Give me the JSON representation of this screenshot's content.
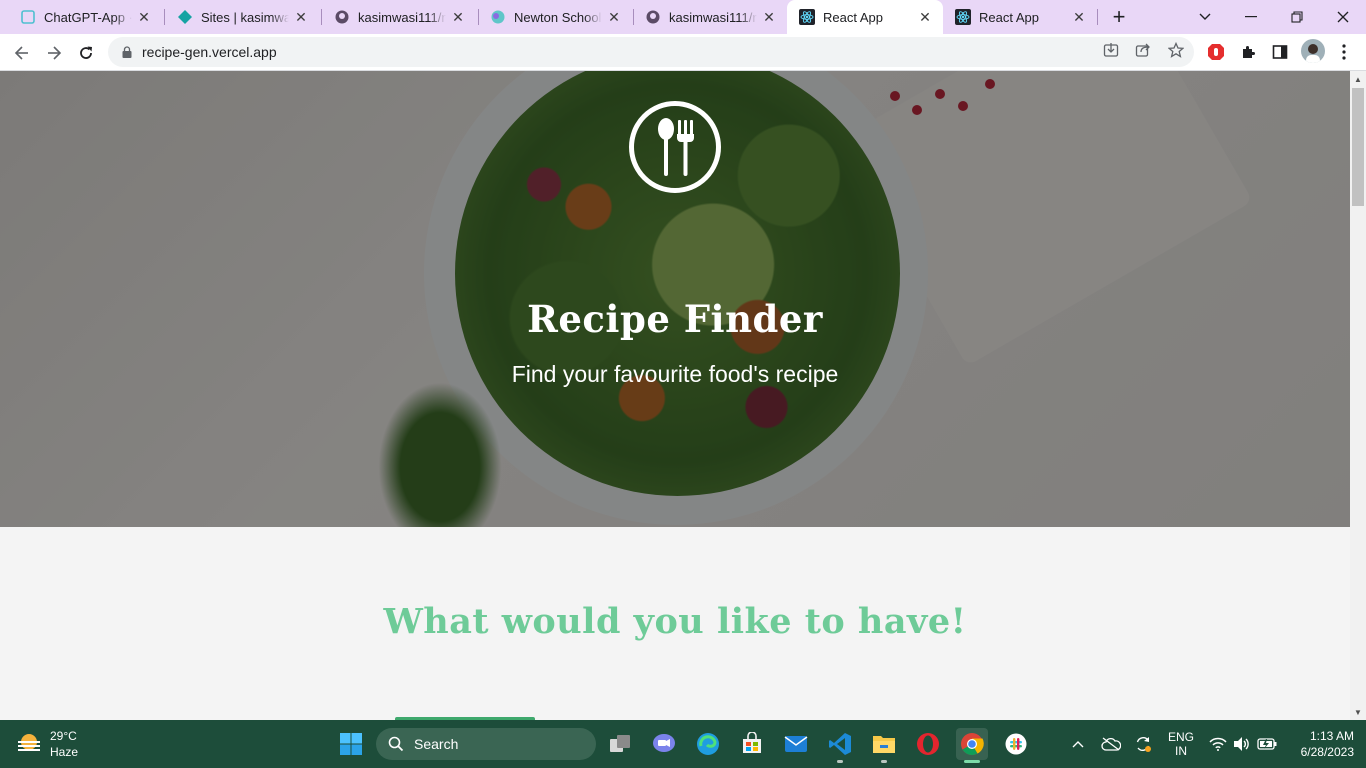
{
  "browser": {
    "tabs": [
      {
        "title": "ChatGPT-App · V",
        "favicon": "chatgpt-app-icon"
      },
      {
        "title": "Sites | kasimwasi1",
        "favicon": "netlify-icon"
      },
      {
        "title": "kasimwasi111/my",
        "favicon": "github-icon"
      },
      {
        "title": "Newton School",
        "favicon": "newton-school-icon"
      },
      {
        "title": "kasimwasi111/re",
        "favicon": "github-icon"
      },
      {
        "title": "React App",
        "favicon": "react-icon",
        "active": true
      },
      {
        "title": "React App",
        "favicon": "react-icon"
      }
    ],
    "url": "recipe-gen.vercel.app"
  },
  "hero": {
    "title": "Recipe Finder",
    "subtitle": "Find your favourite food's recipe",
    "logo": "spoon-fork-icon"
  },
  "main": {
    "heading": "What would you like to have!"
  },
  "taskbar": {
    "weather_temp": "29°C",
    "weather_desc": "Haze",
    "search_label": "Search",
    "lang_line1": "ENG",
    "lang_line2": "IN",
    "time": "1:13 AM",
    "date": "6/28/2023"
  },
  "colors": {
    "tabstrip": "#e9d7f7",
    "heading_green": "#6ecb98",
    "taskbar": "#1d4d3a"
  }
}
